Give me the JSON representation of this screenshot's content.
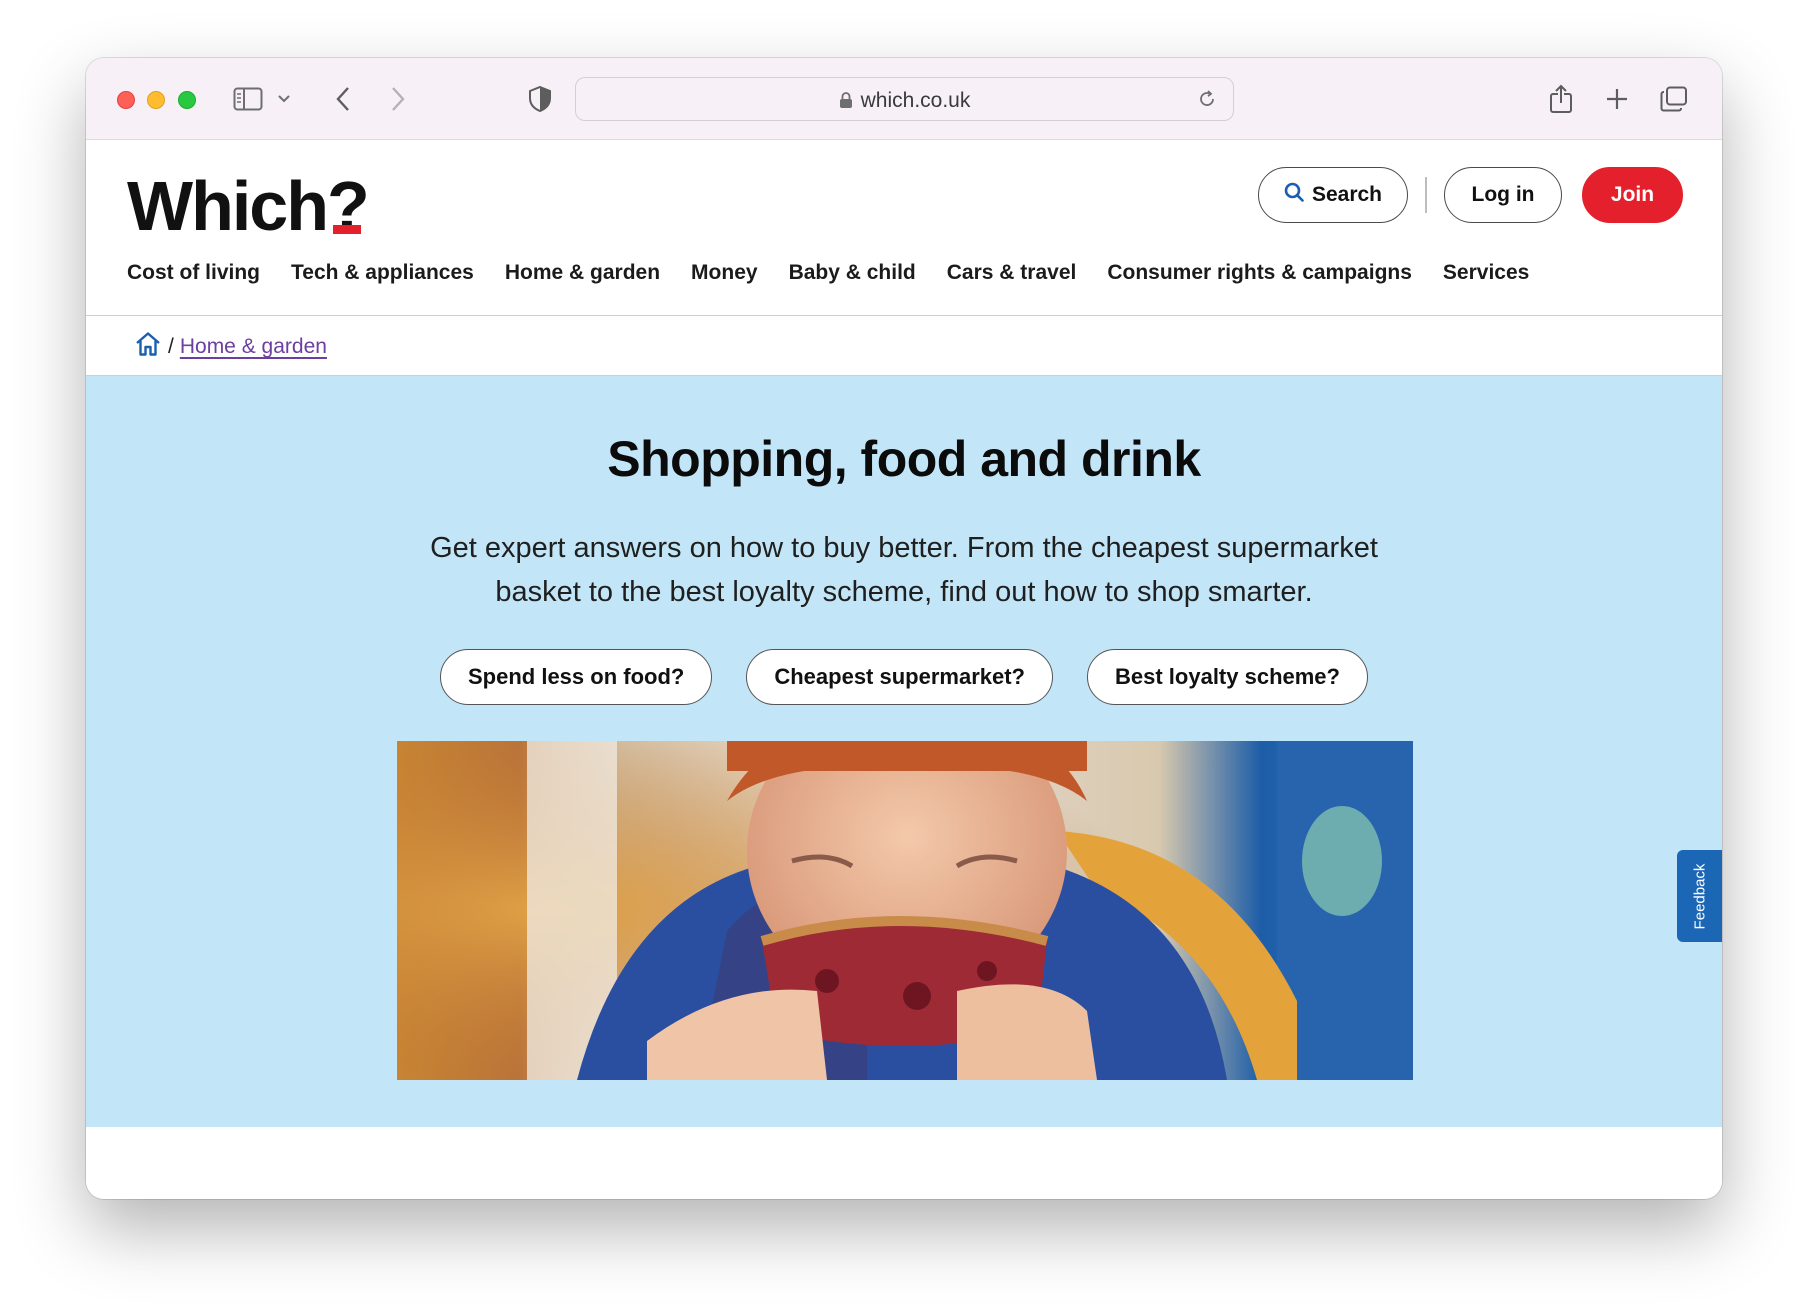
{
  "browser": {
    "url": "which.co.uk"
  },
  "header": {
    "logo_text": "Which",
    "logo_mark": "?",
    "search_label": "Search",
    "login_label": "Log in",
    "join_label": "Join"
  },
  "nav": {
    "items": [
      {
        "label": "Cost of living"
      },
      {
        "label": "Tech & appliances"
      },
      {
        "label": "Home & garden"
      },
      {
        "label": "Money"
      },
      {
        "label": "Baby & child"
      },
      {
        "label": "Cars & travel"
      },
      {
        "label": "Consumer rights & campaigns"
      },
      {
        "label": "Services"
      }
    ]
  },
  "breadcrumb": {
    "separator": "/",
    "link": "Home & garden"
  },
  "hero": {
    "title": "Shopping, food and drink",
    "description": "Get expert answers on how to buy better. From the cheapest supermarket basket to the best loyalty scheme, find out how to shop smarter.",
    "pills": [
      {
        "label": "Spend less on food?"
      },
      {
        "label": "Cheapest supermarket?"
      },
      {
        "label": "Best loyalty scheme?"
      }
    ]
  },
  "feedback": {
    "label": "Feedback"
  },
  "colors": {
    "brand_red": "#e4202d",
    "hero_bg": "#c2e6f7",
    "link_purple": "#6b3fa0",
    "feedback_blue": "#1b67b5"
  },
  "icons": {
    "home": "home-icon",
    "search": "search-icon",
    "lock": "lock-icon",
    "reload": "reload-icon",
    "share": "share-icon",
    "new_tab": "plus-icon",
    "tabs": "tabs-overview-icon",
    "sidebar": "sidebar-icon",
    "back": "back-arrow-icon",
    "forward": "forward-arrow-icon",
    "privacy": "shield-icon"
  }
}
